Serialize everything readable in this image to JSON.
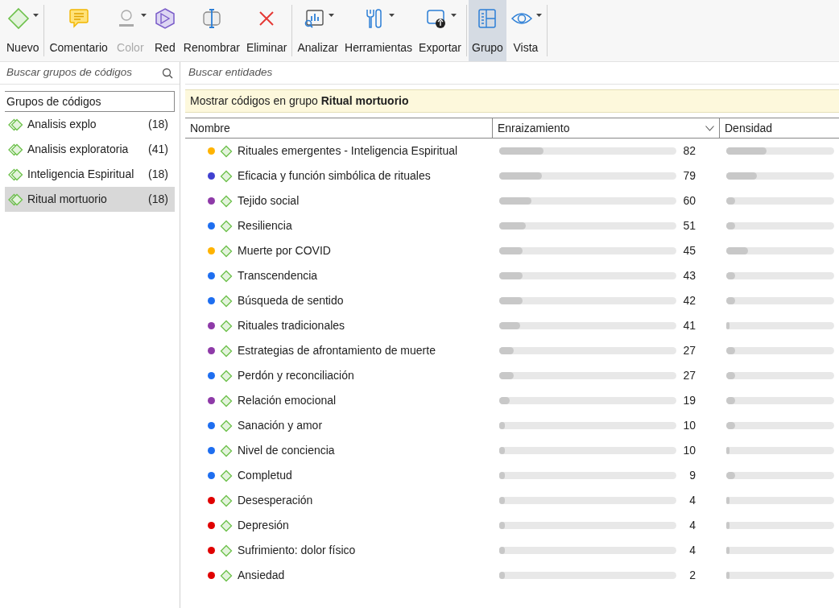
{
  "toolbar": [
    [
      {
        "label": "Nuevo",
        "kind": "diamond",
        "dropdown": true,
        "disabled": false,
        "selected": false
      }
    ],
    [
      {
        "label": "Comentario",
        "kind": "comment",
        "dropdown": false,
        "disabled": false,
        "selected": false
      },
      {
        "label": "Color",
        "kind": "palette",
        "dropdown": true,
        "disabled": true,
        "selected": false
      },
      {
        "label": "Red",
        "kind": "network",
        "dropdown": false,
        "disabled": false,
        "selected": false
      },
      {
        "label": "Renombrar",
        "kind": "rename",
        "dropdown": false,
        "disabled": false,
        "selected": false
      },
      {
        "label": "Eliminar",
        "kind": "delete",
        "dropdown": false,
        "disabled": false,
        "selected": false
      }
    ],
    [
      {
        "label": "Analizar",
        "kind": "analyze",
        "dropdown": true,
        "disabled": false,
        "selected": false
      },
      {
        "label": "Herramientas",
        "kind": "tools",
        "dropdown": true,
        "disabled": false,
        "selected": false
      },
      {
        "label": "Exportar",
        "kind": "export",
        "dropdown": true,
        "disabled": false,
        "selected": false
      }
    ],
    [
      {
        "label": "Grupo",
        "kind": "group",
        "dropdown": false,
        "disabled": false,
        "selected": true
      },
      {
        "label": "Vista",
        "kind": "view",
        "dropdown": true,
        "disabled": false,
        "selected": false
      }
    ]
  ],
  "sidebar": {
    "search": {
      "placeholder": "Buscar grupos de códigos"
    },
    "header": "Grupos de códigos",
    "items": [
      {
        "label": "Analisis explo",
        "count": "(18)",
        "selected": false
      },
      {
        "label": "Analisis exploratoria",
        "count": "(41)",
        "selected": false
      },
      {
        "label": "Inteligencia Espiritual",
        "count": "(18)",
        "selected": false
      },
      {
        "label": "Ritual mortuorio",
        "count": "(18)",
        "selected": true
      }
    ]
  },
  "main": {
    "search": {
      "placeholder": "Buscar entidades"
    },
    "filter_banner": {
      "text": "Mostrar códigos en grupo",
      "group": "Ritual mortuorio"
    },
    "table": {
      "columns": [
        {
          "label": "Nombre",
          "sorted": false
        },
        {
          "label": "Enraizamiento",
          "sorted": true
        },
        {
          "label": "Densidad",
          "sorted": false
        }
      ],
      "rows": [
        {
          "name": "Rituales emergentes - Inteligencia Espiritual",
          "color": "#ffb300",
          "groundedness": {
            "value": "82",
            "level": 0.25
          },
          "density": {
            "level": 0.37
          }
        },
        {
          "name": "Eficacia y función simbólica de rituales",
          "color": "#4040d0",
          "groundedness": {
            "value": "79",
            "level": 0.24
          },
          "density": {
            "level": 0.28
          }
        },
        {
          "name": "Tejido social",
          "color": "#8e3aa8",
          "groundedness": {
            "value": "60",
            "level": 0.18
          },
          "density": {
            "level": 0.08
          }
        },
        {
          "name": "Resiliencia",
          "color": "#1e6ef0",
          "groundedness": {
            "value": "51",
            "level": 0.15
          },
          "density": {
            "level": 0.08
          }
        },
        {
          "name": "Muerte por  COVID",
          "color": "#ffb300",
          "groundedness": {
            "value": "45",
            "level": 0.13
          },
          "density": {
            "level": 0.2
          }
        },
        {
          "name": "Transcendencia",
          "color": "#1e6ef0",
          "groundedness": {
            "value": "43",
            "level": 0.13
          },
          "density": {
            "level": 0.08
          }
        },
        {
          "name": "Búsqueda de sentido",
          "color": "#1e6ef0",
          "groundedness": {
            "value": "42",
            "level": 0.13
          },
          "density": {
            "level": 0.08
          }
        },
        {
          "name": "Rituales tradicionales",
          "color": "#8e3aa8",
          "groundedness": {
            "value": "41",
            "level": 0.12
          },
          "density": {
            "level": 0.03
          }
        },
        {
          "name": "Estrategias de afrontamiento de muerte",
          "color": "#8e3aa8",
          "groundedness": {
            "value": "27",
            "level": 0.08
          },
          "density": {
            "level": 0.08
          }
        },
        {
          "name": "Perdón y reconciliación",
          "color": "#1e6ef0",
          "groundedness": {
            "value": "27",
            "level": 0.08
          },
          "density": {
            "level": 0.08
          }
        },
        {
          "name": "Relación emocional",
          "color": "#8e3aa8",
          "groundedness": {
            "value": "19",
            "level": 0.06
          },
          "density": {
            "level": 0.08
          }
        },
        {
          "name": "Sanación y amor",
          "color": "#1e6ef0",
          "groundedness": {
            "value": "10",
            "level": 0.03
          },
          "density": {
            "level": 0.08
          }
        },
        {
          "name": "Nivel de conciencia",
          "color": "#1e6ef0",
          "groundedness": {
            "value": "10",
            "level": 0.03
          },
          "density": {
            "level": 0.03
          }
        },
        {
          "name": "Completud",
          "color": "#1e6ef0",
          "groundedness": {
            "value": "9",
            "level": 0.03
          },
          "density": {
            "level": 0.08
          }
        },
        {
          "name": "Desesperación",
          "color": "#e00000",
          "groundedness": {
            "value": "4",
            "level": 0.01
          },
          "density": {
            "level": 0.03
          }
        },
        {
          "name": "Depresión",
          "color": "#e00000",
          "groundedness": {
            "value": "4",
            "level": 0.01
          },
          "density": {
            "level": 0.03
          }
        },
        {
          "name": "Sufrimiento: dolor físico",
          "color": "#e00000",
          "groundedness": {
            "value": "4",
            "level": 0.01
          },
          "density": {
            "level": 0.03
          }
        },
        {
          "name": "Ansiedad",
          "color": "#e00000",
          "groundedness": {
            "value": "2",
            "level": 0.01
          },
          "density": {
            "level": 0.03
          }
        }
      ]
    }
  }
}
